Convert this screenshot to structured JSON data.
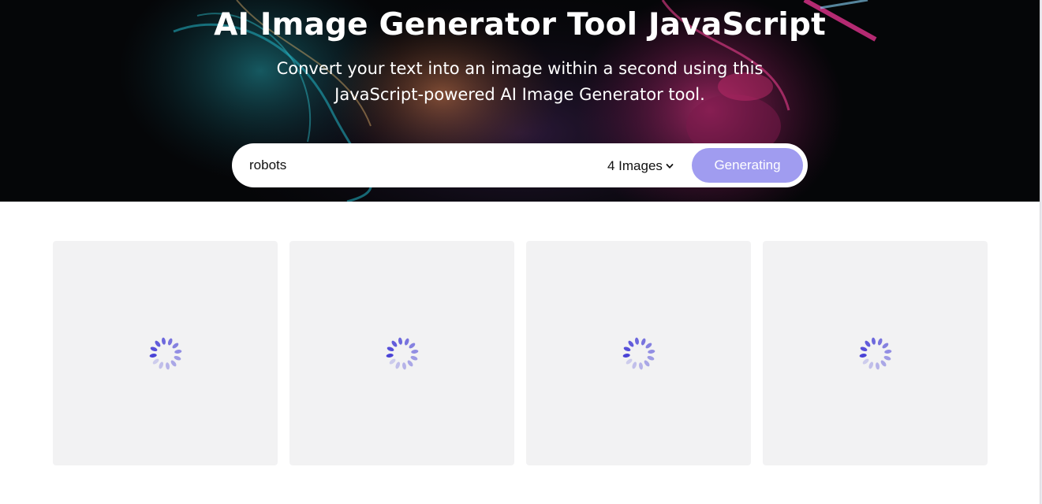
{
  "hero": {
    "title": "AI Image Generator Tool JavaScript",
    "subtitle": "Convert your text into an image within a second using this JavaScript-powered AI Image Generator tool."
  },
  "form": {
    "prompt_value": "robots",
    "image_count": "4 Images",
    "button_label": "Generating"
  },
  "gallery": {
    "cards": [
      {
        "state": "loading"
      },
      {
        "state": "loading"
      },
      {
        "state": "loading"
      },
      {
        "state": "loading"
      }
    ],
    "spinner_icon": "loading-spinner-icon"
  },
  "colors": {
    "accent": "#a09cf0",
    "spinner": "#4a43d6",
    "card_bg": "#f2f2f3"
  }
}
